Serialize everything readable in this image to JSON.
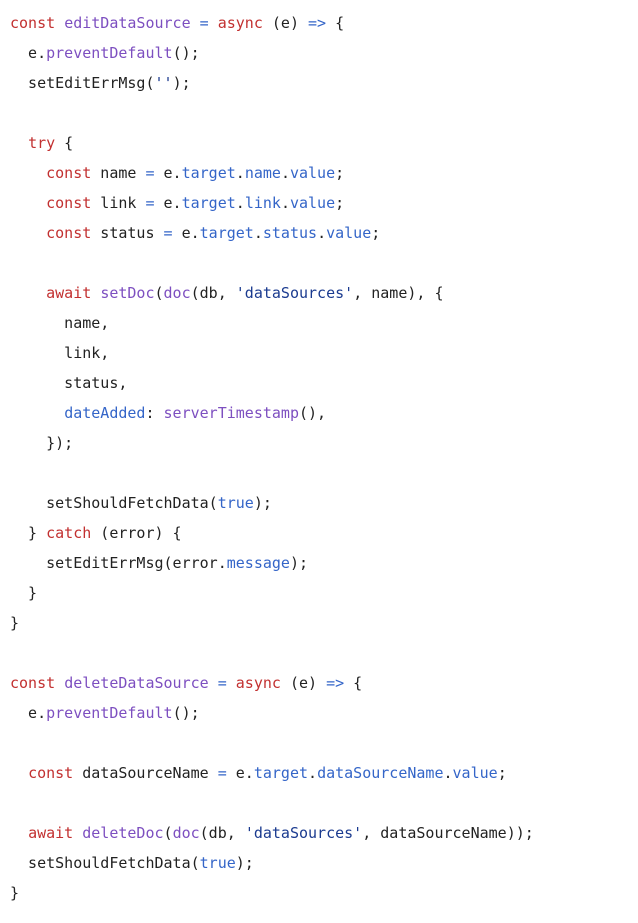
{
  "editor": {
    "language": "javascript",
    "background_color": "#ffffff",
    "font_size_px": 15,
    "line_height_px": 30,
    "theme_colors": {
      "keyword": "#c23030",
      "function": "#7d4fc0",
      "property": "#3465c8",
      "string": "#1a3a8f",
      "plain": "#222222",
      "operator": "#3465c8",
      "background": "#ffffff"
    }
  },
  "code": {
    "lines": [
      {
        "index": 1,
        "text": "const editDataSource = async (e) => {",
        "tokens": [
          {
            "t": "const",
            "c": "keyword"
          },
          {
            "t": " ",
            "c": "plain"
          },
          {
            "t": "editDataSource",
            "c": "function"
          },
          {
            "t": " ",
            "c": "plain"
          },
          {
            "t": "=",
            "c": "operator"
          },
          {
            "t": " ",
            "c": "plain"
          },
          {
            "t": "async",
            "c": "keyword"
          },
          {
            "t": " (e) ",
            "c": "plain"
          },
          {
            "t": "=>",
            "c": "operator"
          },
          {
            "t": " {",
            "c": "plain"
          }
        ]
      },
      {
        "index": 2,
        "text": "  e.preventDefault();",
        "tokens": [
          {
            "t": "  e.",
            "c": "plain"
          },
          {
            "t": "preventDefault",
            "c": "function"
          },
          {
            "t": "();",
            "c": "plain"
          }
        ]
      },
      {
        "index": 3,
        "text": "  setEditErrMsg('');",
        "tokens": [
          {
            "t": "  setEditErrMsg(",
            "c": "plain"
          },
          {
            "t": "''",
            "c": "string"
          },
          {
            "t": ");",
            "c": "plain"
          }
        ]
      },
      {
        "index": 4,
        "text": "",
        "tokens": []
      },
      {
        "index": 5,
        "text": "  try {",
        "tokens": [
          {
            "t": "  ",
            "c": "plain"
          },
          {
            "t": "try",
            "c": "keyword"
          },
          {
            "t": " {",
            "c": "plain"
          }
        ]
      },
      {
        "index": 6,
        "text": "    const name = e.target.name.value;",
        "tokens": [
          {
            "t": "    ",
            "c": "plain"
          },
          {
            "t": "const",
            "c": "keyword"
          },
          {
            "t": " name ",
            "c": "plain"
          },
          {
            "t": "=",
            "c": "operator"
          },
          {
            "t": " e.",
            "c": "plain"
          },
          {
            "t": "target",
            "c": "property"
          },
          {
            "t": ".",
            "c": "plain"
          },
          {
            "t": "name",
            "c": "property"
          },
          {
            "t": ".",
            "c": "plain"
          },
          {
            "t": "value",
            "c": "property"
          },
          {
            "t": ";",
            "c": "plain"
          }
        ]
      },
      {
        "index": 7,
        "text": "    const link = e.target.link.value;",
        "tokens": [
          {
            "t": "    ",
            "c": "plain"
          },
          {
            "t": "const",
            "c": "keyword"
          },
          {
            "t": " link ",
            "c": "plain"
          },
          {
            "t": "=",
            "c": "operator"
          },
          {
            "t": " e.",
            "c": "plain"
          },
          {
            "t": "target",
            "c": "property"
          },
          {
            "t": ".",
            "c": "plain"
          },
          {
            "t": "link",
            "c": "property"
          },
          {
            "t": ".",
            "c": "plain"
          },
          {
            "t": "value",
            "c": "property"
          },
          {
            "t": ";",
            "c": "plain"
          }
        ]
      },
      {
        "index": 8,
        "text": "    const status = e.target.status.value;",
        "tokens": [
          {
            "t": "    ",
            "c": "plain"
          },
          {
            "t": "const",
            "c": "keyword"
          },
          {
            "t": " status ",
            "c": "plain"
          },
          {
            "t": "=",
            "c": "operator"
          },
          {
            "t": " e.",
            "c": "plain"
          },
          {
            "t": "target",
            "c": "property"
          },
          {
            "t": ".",
            "c": "plain"
          },
          {
            "t": "status",
            "c": "property"
          },
          {
            "t": ".",
            "c": "plain"
          },
          {
            "t": "value",
            "c": "property"
          },
          {
            "t": ";",
            "c": "plain"
          }
        ]
      },
      {
        "index": 9,
        "text": "",
        "tokens": []
      },
      {
        "index": 10,
        "text": "    await setDoc(doc(db, 'dataSources', name), {",
        "tokens": [
          {
            "t": "    ",
            "c": "plain"
          },
          {
            "t": "await",
            "c": "keyword"
          },
          {
            "t": " ",
            "c": "plain"
          },
          {
            "t": "setDoc",
            "c": "function"
          },
          {
            "t": "(",
            "c": "plain"
          },
          {
            "t": "doc",
            "c": "function"
          },
          {
            "t": "(db, ",
            "c": "plain"
          },
          {
            "t": "'dataSources'",
            "c": "string"
          },
          {
            "t": ", name), {",
            "c": "plain"
          }
        ]
      },
      {
        "index": 11,
        "text": "      name,",
        "tokens": [
          {
            "t": "      name,",
            "c": "plain"
          }
        ]
      },
      {
        "index": 12,
        "text": "      link,",
        "tokens": [
          {
            "t": "      link,",
            "c": "plain"
          }
        ]
      },
      {
        "index": 13,
        "text": "      status,",
        "tokens": [
          {
            "t": "      status,",
            "c": "plain"
          }
        ]
      },
      {
        "index": 14,
        "text": "      dateAdded: serverTimestamp(),",
        "tokens": [
          {
            "t": "      ",
            "c": "plain"
          },
          {
            "t": "dateAdded",
            "c": "property"
          },
          {
            "t": ": ",
            "c": "plain"
          },
          {
            "t": "serverTimestamp",
            "c": "function"
          },
          {
            "t": "(),",
            "c": "plain"
          }
        ]
      },
      {
        "index": 15,
        "text": "    });",
        "tokens": [
          {
            "t": "    });",
            "c": "plain"
          }
        ]
      },
      {
        "index": 16,
        "text": "",
        "tokens": []
      },
      {
        "index": 17,
        "text": "    setShouldFetchData(true);",
        "tokens": [
          {
            "t": "    setShouldFetchData(",
            "c": "plain"
          },
          {
            "t": "true",
            "c": "property"
          },
          {
            "t": ");",
            "c": "plain"
          }
        ]
      },
      {
        "index": 18,
        "text": "  } catch (error) {",
        "tokens": [
          {
            "t": "  } ",
            "c": "plain"
          },
          {
            "t": "catch",
            "c": "keyword"
          },
          {
            "t": " (error) {",
            "c": "plain"
          }
        ]
      },
      {
        "index": 19,
        "text": "    setEditErrMsg(error.message);",
        "tokens": [
          {
            "t": "    setEditErrMsg(error.",
            "c": "plain"
          },
          {
            "t": "message",
            "c": "property"
          },
          {
            "t": ");",
            "c": "plain"
          }
        ]
      },
      {
        "index": 20,
        "text": "  }",
        "tokens": [
          {
            "t": "  }",
            "c": "plain"
          }
        ]
      },
      {
        "index": 21,
        "text": "}",
        "tokens": [
          {
            "t": "}",
            "c": "plain"
          }
        ]
      },
      {
        "index": 22,
        "text": "",
        "tokens": []
      },
      {
        "index": 23,
        "text": "const deleteDataSource = async (e) => {",
        "tokens": [
          {
            "t": "const",
            "c": "keyword"
          },
          {
            "t": " ",
            "c": "plain"
          },
          {
            "t": "deleteDataSource",
            "c": "function"
          },
          {
            "t": " ",
            "c": "plain"
          },
          {
            "t": "=",
            "c": "operator"
          },
          {
            "t": " ",
            "c": "plain"
          },
          {
            "t": "async",
            "c": "keyword"
          },
          {
            "t": " (e) ",
            "c": "plain"
          },
          {
            "t": "=>",
            "c": "operator"
          },
          {
            "t": " {",
            "c": "plain"
          }
        ]
      },
      {
        "index": 24,
        "text": "  e.preventDefault();",
        "tokens": [
          {
            "t": "  e.",
            "c": "plain"
          },
          {
            "t": "preventDefault",
            "c": "function"
          },
          {
            "t": "();",
            "c": "plain"
          }
        ]
      },
      {
        "index": 25,
        "text": "",
        "tokens": []
      },
      {
        "index": 26,
        "text": "  const dataSourceName = e.target.dataSourceName.value;",
        "tokens": [
          {
            "t": "  ",
            "c": "plain"
          },
          {
            "t": "const",
            "c": "keyword"
          },
          {
            "t": " dataSourceName ",
            "c": "plain"
          },
          {
            "t": "=",
            "c": "operator"
          },
          {
            "t": " e.",
            "c": "plain"
          },
          {
            "t": "target",
            "c": "property"
          },
          {
            "t": ".",
            "c": "plain"
          },
          {
            "t": "dataSourceName",
            "c": "property"
          },
          {
            "t": ".",
            "c": "plain"
          },
          {
            "t": "value",
            "c": "property"
          },
          {
            "t": ";",
            "c": "plain"
          }
        ]
      },
      {
        "index": 27,
        "text": "",
        "tokens": []
      },
      {
        "index": 28,
        "text": "  await deleteDoc(doc(db, 'dataSources', dataSourceName));",
        "tokens": [
          {
            "t": "  ",
            "c": "plain"
          },
          {
            "t": "await",
            "c": "keyword"
          },
          {
            "t": " ",
            "c": "plain"
          },
          {
            "t": "deleteDoc",
            "c": "function"
          },
          {
            "t": "(",
            "c": "plain"
          },
          {
            "t": "doc",
            "c": "function"
          },
          {
            "t": "(db, ",
            "c": "plain"
          },
          {
            "t": "'dataSources'",
            "c": "string"
          },
          {
            "t": ", dataSourceName));",
            "c": "plain"
          }
        ]
      },
      {
        "index": 29,
        "text": "  setShouldFetchData(true);",
        "tokens": [
          {
            "t": "  setShouldFetchData(",
            "c": "plain"
          },
          {
            "t": "true",
            "c": "property"
          },
          {
            "t": ");",
            "c": "plain"
          }
        ]
      },
      {
        "index": 30,
        "text": "}",
        "tokens": [
          {
            "t": "}",
            "c": "plain"
          }
        ]
      }
    ]
  }
}
